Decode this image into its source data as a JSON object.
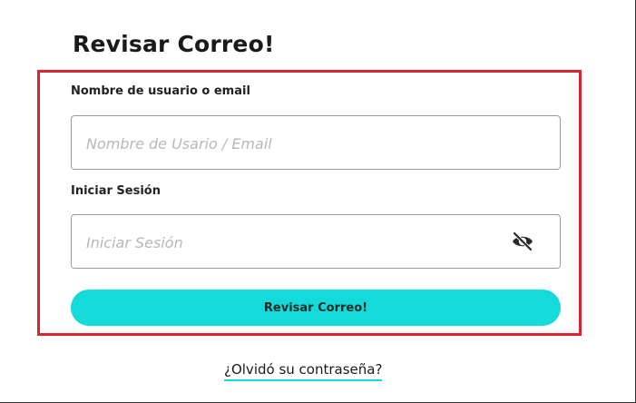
{
  "form": {
    "title": "Revisar Correo!",
    "username": {
      "label": "Nombre de usuario o email",
      "placeholder": "Nombre de Usario / Email",
      "value": ""
    },
    "password": {
      "label": "Iniciar Sesión",
      "placeholder": "Iniciar Sesión",
      "value": "",
      "toggle_icon": "eye-slash-icon"
    },
    "submit_label": "Revisar Correo!",
    "forgot_link": "¿Olvidó su contraseña?"
  },
  "colors": {
    "accent": "#14dbd9",
    "title_highlight": "#a7f3ee",
    "annotation_border": "#d7262f"
  }
}
